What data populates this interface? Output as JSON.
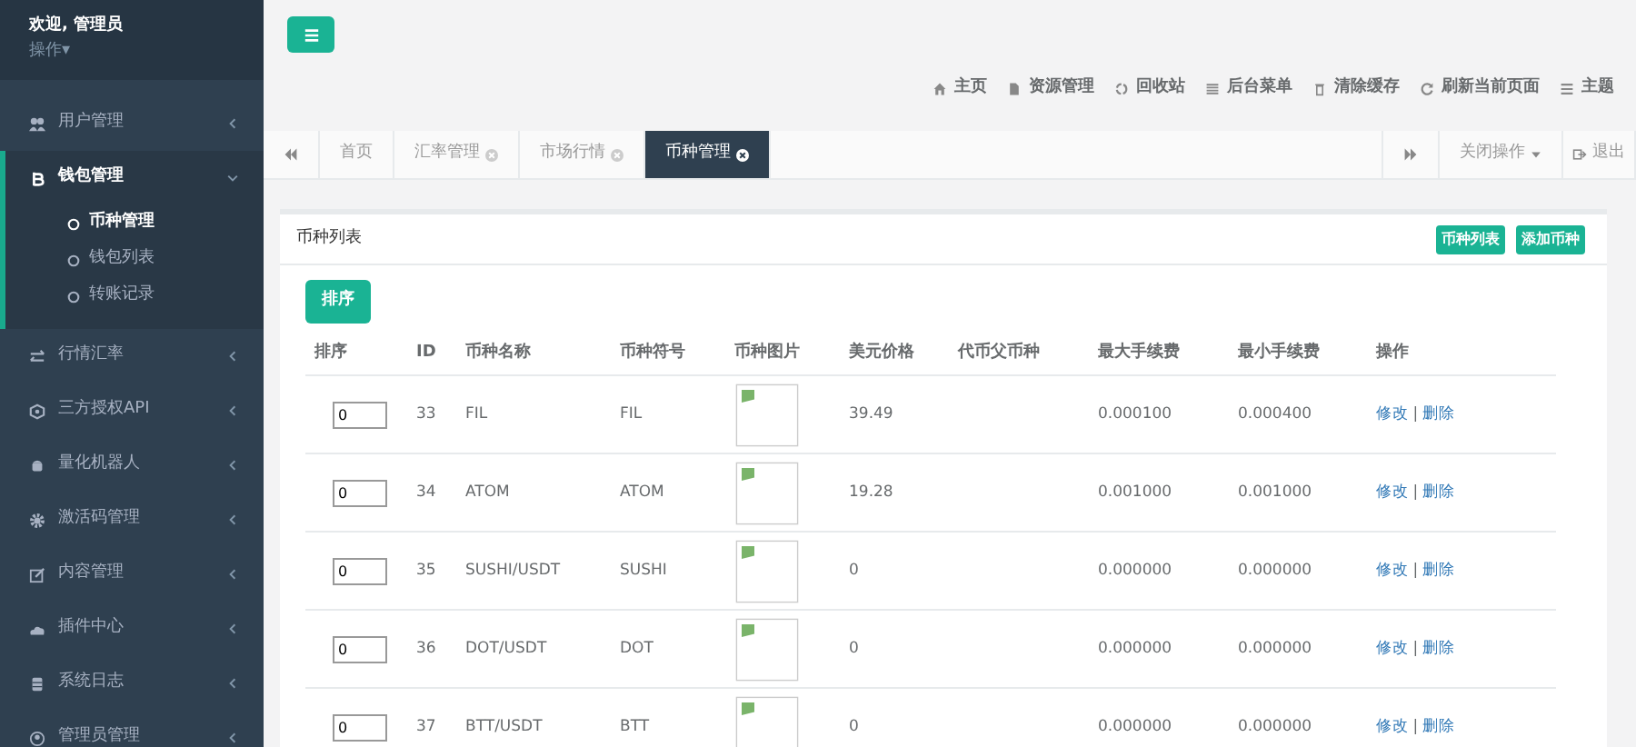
{
  "sidebar": {
    "welcome": "欢迎, 管理员",
    "action_menu": "操作",
    "action_caret": "▾",
    "items": [
      {
        "label": "用户管理",
        "expanded": false
      },
      {
        "label": "钱包管理",
        "expanded": true,
        "children": [
          {
            "label": "币种管理",
            "selected": true
          },
          {
            "label": "钱包列表",
            "selected": false
          },
          {
            "label": "转账记录",
            "selected": false
          }
        ]
      },
      {
        "label": "行情汇率",
        "expanded": false
      },
      {
        "label": "三方授权API",
        "expanded": false
      },
      {
        "label": "量化机器人",
        "expanded": false
      },
      {
        "label": "激活码管理",
        "expanded": false
      },
      {
        "label": "内容管理",
        "expanded": false
      },
      {
        "label": "插件中心",
        "expanded": false
      },
      {
        "label": "系统日志",
        "expanded": false
      },
      {
        "label": "管理员管理",
        "expanded": false
      }
    ]
  },
  "top_links": [
    "主页",
    "资源管理",
    "回收站",
    "后台菜单",
    "清除缓存",
    "刷新当前页面",
    "主题"
  ],
  "tabs": [
    {
      "label": "首页",
      "closable": false,
      "selected": false
    },
    {
      "label": "汇率管理",
      "closable": true,
      "selected": false
    },
    {
      "label": "市场行情",
      "closable": true,
      "selected": false
    },
    {
      "label": "币种管理",
      "closable": true,
      "selected": true
    }
  ],
  "tab_actions": {
    "close_menu": "关闭操作",
    "logout": "退出"
  },
  "panel": {
    "title": "币种列表",
    "header_buttons": [
      "币种列表",
      "添加币种"
    ],
    "sort_button": "排序",
    "table": {
      "columns": [
        "排序",
        "ID",
        "币种名称",
        "币种符号",
        "币种图片",
        "美元价格",
        "代币父币种",
        "最大手续费",
        "最小手续费",
        "操作"
      ],
      "rows": [
        {
          "sort": "0",
          "id": "33",
          "name": "FIL",
          "symbol": "FIL",
          "price": "39.49",
          "max_fee": "0.000100",
          "min_fee": "0.000400",
          "edit": "修改",
          "separator": "|",
          "delete": "删除"
        },
        {
          "sort": "0",
          "id": "34",
          "name": "ATOM",
          "symbol": "ATOM",
          "price": "19.28",
          "max_fee": "0.001000",
          "min_fee": "0.001000",
          "edit": "修改",
          "separator": "|",
          "delete": "删除"
        },
        {
          "sort": "0",
          "id": "35",
          "name": "SUSHI/USDT",
          "symbol": "SUSHI",
          "price": "0",
          "max_fee": "0.000000",
          "min_fee": "0.000000",
          "edit": "修改",
          "separator": "|",
          "delete": "删除"
        },
        {
          "sort": "0",
          "id": "36",
          "name": "DOT/USDT",
          "symbol": "DOT",
          "price": "0",
          "max_fee": "0.000000",
          "min_fee": "0.000000",
          "edit": "修改",
          "separator": "|",
          "delete": "删除"
        },
        {
          "sort": "0",
          "id": "37",
          "name": "BTT/USDT",
          "symbol": "BTT",
          "price": "0",
          "max_fee": "0.000000",
          "min_fee": "0.000000",
          "edit": "修改",
          "separator": "|",
          "delete": "删除"
        }
      ]
    }
  }
}
